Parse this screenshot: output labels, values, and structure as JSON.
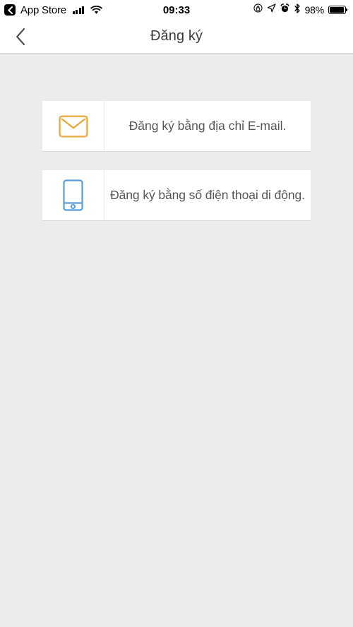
{
  "status_bar": {
    "back_app_label": "App Store",
    "back_icon": "chevron-left-icon",
    "signal_icon": "cellular-signal-icon",
    "wifi_icon": "wifi-icon",
    "time": "09:33",
    "rotation_lock_icon": "rotation-lock-icon",
    "location_icon": "location-arrow-icon",
    "alarm_icon": "alarm-clock-icon",
    "bluetooth_icon": "bluetooth-icon",
    "battery_percent": "98%",
    "battery_icon": "battery-icon",
    "battery_level": 98
  },
  "nav_bar": {
    "back_icon": "chevron-left-icon",
    "title": "Đăng ký"
  },
  "main": {
    "options": [
      {
        "id": "email",
        "icon": "envelope-icon",
        "icon_color": "#e8a83c",
        "label": "Đăng ký bằng địa chỉ E-mail."
      },
      {
        "id": "phone",
        "icon": "mobile-phone-icon",
        "icon_color": "#5b9bd8",
        "label": "Đăng ký bằng số điện thoại di động."
      }
    ]
  },
  "theme": {
    "background": "#ececec",
    "card_background": "#ffffff",
    "text_primary": "#3b3b3b",
    "text_secondary": "#555555",
    "accent_orange": "#e8a83c",
    "accent_blue": "#5b9bd8"
  }
}
